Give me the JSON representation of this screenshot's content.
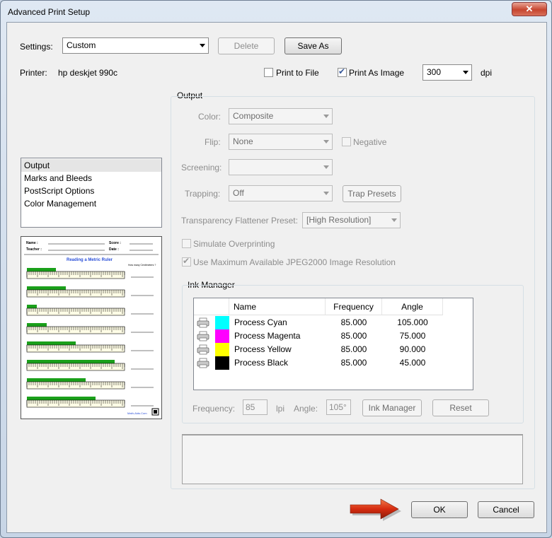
{
  "window": {
    "title": "Advanced Print Setup",
    "close_label": "✕"
  },
  "settings": {
    "label": "Settings:",
    "value": "Custom",
    "delete_label": "Delete",
    "save_as_label": "Save As"
  },
  "printer": {
    "label": "Printer:",
    "name": "hp deskjet 990c",
    "print_to_file_label": "Print to File",
    "print_to_file_checked": false,
    "print_as_image_label": "Print As Image",
    "print_as_image_checked": true,
    "dpi_value": "300",
    "dpi_unit": "dpi"
  },
  "sidebar": {
    "items": [
      {
        "label": "Output",
        "selected": true
      },
      {
        "label": "Marks and Bleeds",
        "selected": false
      },
      {
        "label": "PostScript Options",
        "selected": false
      },
      {
        "label": "Color Management",
        "selected": false
      }
    ]
  },
  "output": {
    "heading": "Output",
    "color_label": "Color:",
    "color_value": "Composite",
    "flip_label": "Flip:",
    "flip_value": "None",
    "negative_label": "Negative",
    "screening_label": "Screening:",
    "screening_value": "",
    "trapping_label": "Trapping:",
    "trapping_value": "Off",
    "trap_presets_label": "Trap Presets",
    "flattener_label": "Transparency Flattener Preset:",
    "flattener_value": "[High Resolution]",
    "simulate_overprinting_label": "Simulate Overprinting",
    "jpeg2000_label": "Use Maximum Available JPEG2000 Image Resolution"
  },
  "ink_manager": {
    "heading": "Ink Manager",
    "columns": {
      "name": "Name",
      "frequency": "Frequency",
      "angle": "Angle"
    },
    "inks": [
      {
        "name": "Process Cyan",
        "frequency": "85.000",
        "angle": "105.000",
        "color": "#00ffff"
      },
      {
        "name": "Process Magenta",
        "frequency": "85.000",
        "angle": "75.000",
        "color": "#ff00ff"
      },
      {
        "name": "Process Yellow",
        "frequency": "85.000",
        "angle": "90.000",
        "color": "#ffff00"
      },
      {
        "name": "Process Black",
        "frequency": "85.000",
        "angle": "45.000",
        "color": "#000000"
      }
    ],
    "frequency_label": "Frequency:",
    "frequency_value": "85",
    "lpi_label": "lpi",
    "angle_label": "Angle:",
    "angle_value": "105°",
    "ink_manager_button": "Ink Manager",
    "reset_button": "Reset"
  },
  "preview": {
    "name_label": "Name :",
    "score_label": "Score :",
    "teacher_label": "Teacher :",
    "date_label": "Date :",
    "worksheet_title": "Reading a Metric Ruler",
    "side_note": "How many Centimeters ?",
    "footer_site": "Math-Aids.Com",
    "bar_levels": [
      0.3,
      0.4,
      0.1,
      0.2,
      0.5,
      0.9,
      0.6,
      0.7
    ]
  },
  "footer": {
    "ok_label": "OK",
    "cancel_label": "Cancel"
  }
}
